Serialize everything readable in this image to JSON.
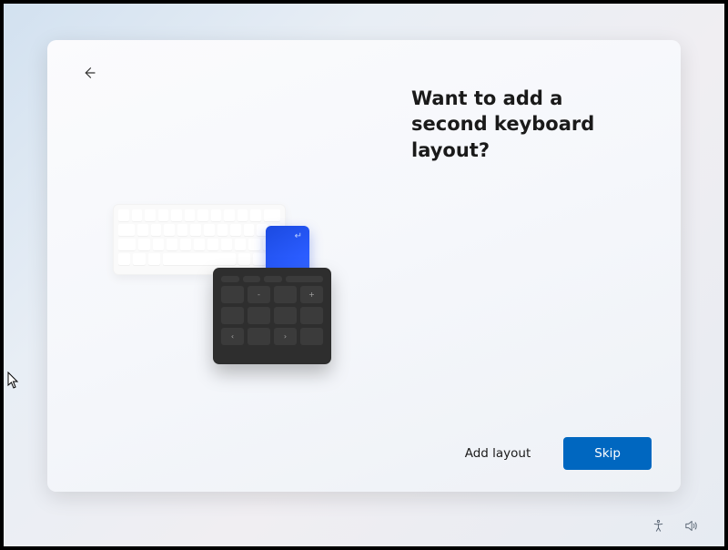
{
  "heading": "Want to add a second keyboard layout?",
  "buttons": {
    "add_layout": "Add layout",
    "skip": "Skip"
  },
  "icons": {
    "back": "back-arrow",
    "accessibility": "accessibility-icon",
    "volume": "volume-icon"
  }
}
